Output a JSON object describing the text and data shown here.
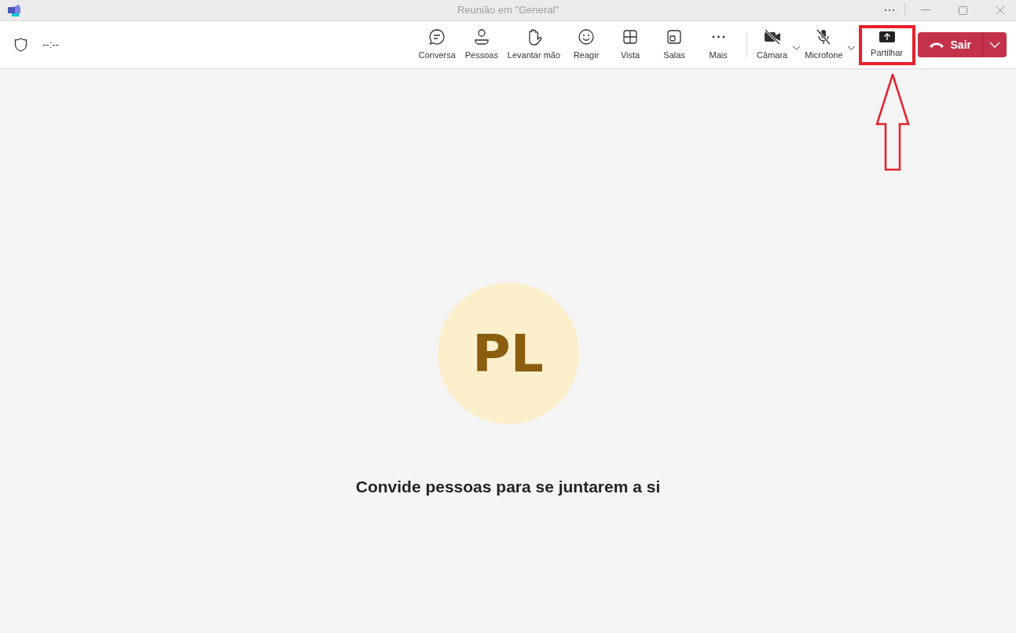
{
  "window": {
    "title": "Reunião em \"General\""
  },
  "timer": "--:--",
  "toolbar": [
    {
      "kind": "chat",
      "label": "Conversa"
    },
    {
      "kind": "people",
      "label": "Pessoas"
    },
    {
      "kind": "hand",
      "label": "Levantar mão"
    },
    {
      "kind": "react",
      "label": "Reagir"
    },
    {
      "kind": "view",
      "label": "Vista"
    },
    {
      "kind": "rooms",
      "label": "Salas"
    },
    {
      "kind": "more",
      "label": "Mais"
    }
  ],
  "devices": [
    {
      "kind": "camera",
      "label": "Câmara",
      "on": false
    },
    {
      "kind": "mic",
      "label": "Microfone",
      "on": false
    }
  ],
  "share": {
    "label": "Partilhar",
    "highlighted": true
  },
  "leave": {
    "label": "Sair"
  },
  "participant": {
    "initials": "PL"
  },
  "message": "Convide pessoas para se juntarem a si"
}
